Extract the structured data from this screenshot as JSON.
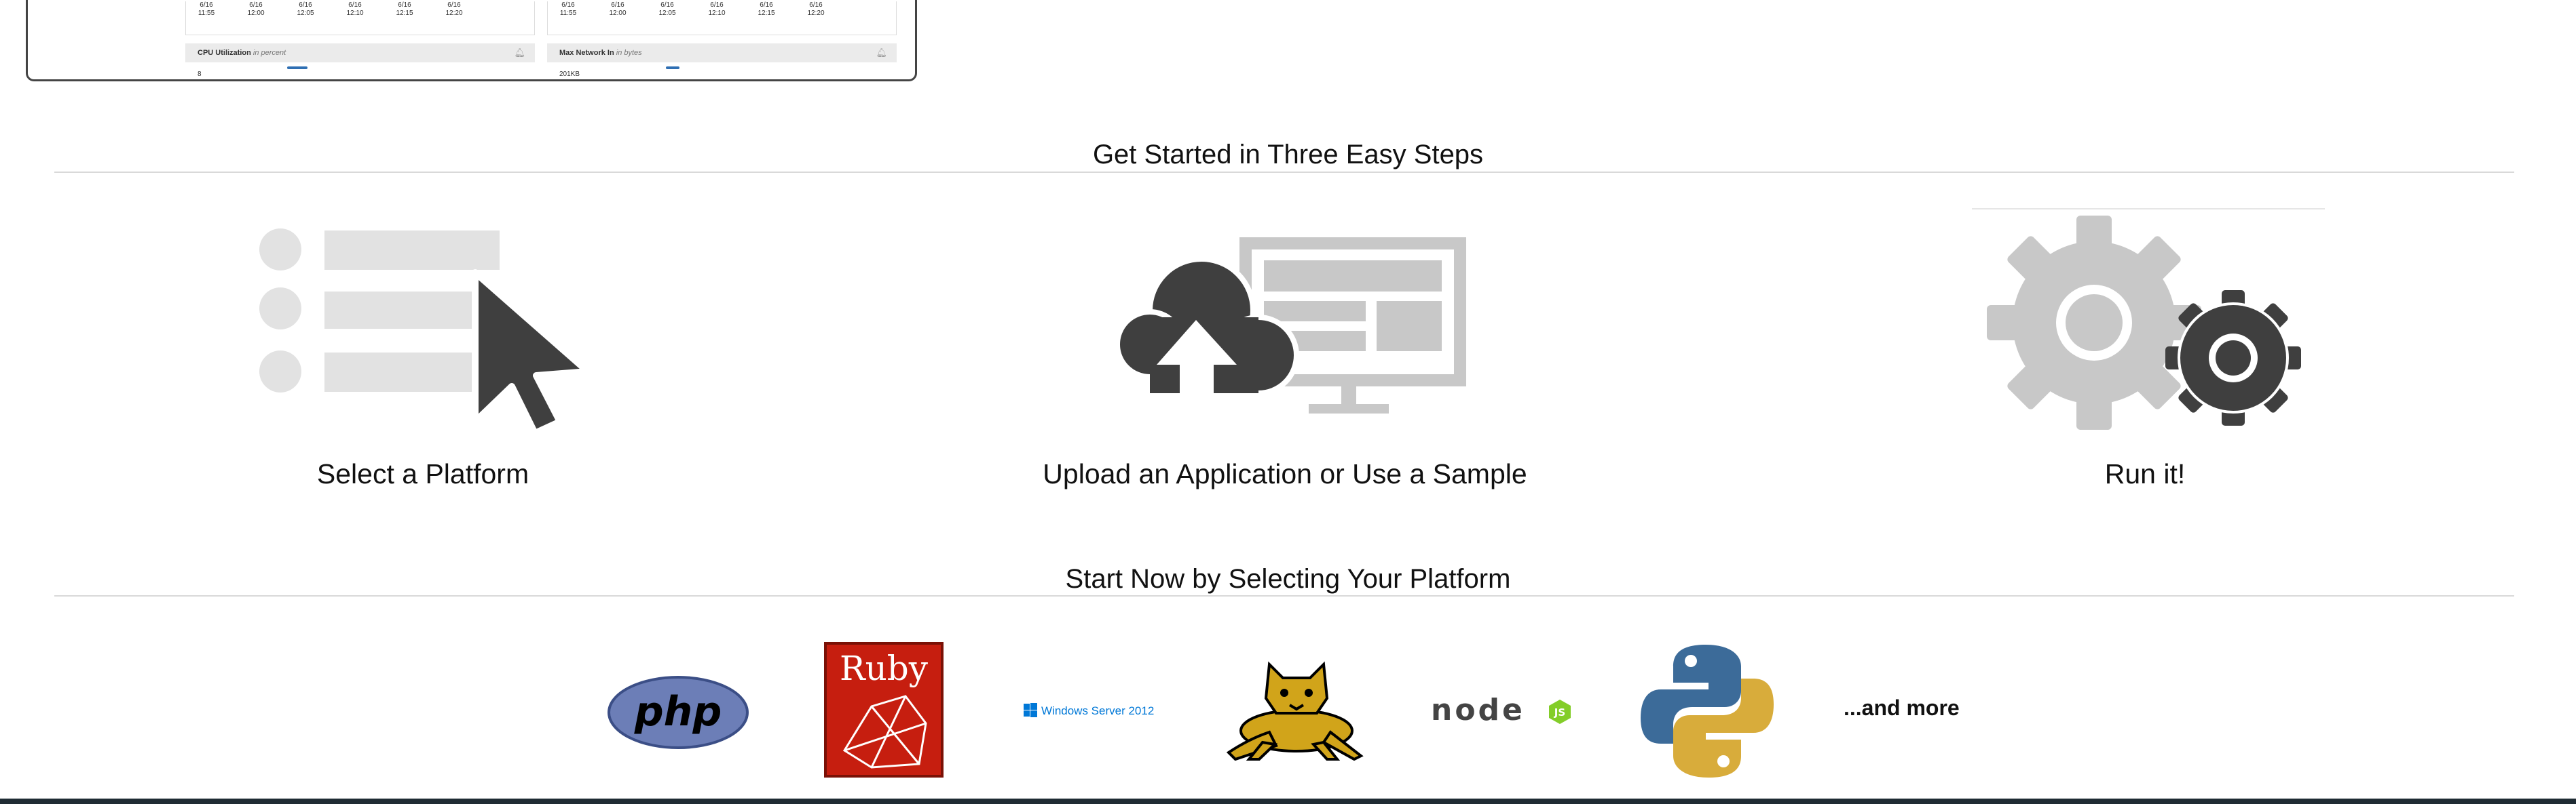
{
  "preview": {
    "left_panel": {
      "ticks": [
        {
          "date": "6/16",
          "time": "11:55"
        },
        {
          "date": "6/16",
          "time": "12:00"
        },
        {
          "date": "6/16",
          "time": "12:05"
        },
        {
          "date": "6/16",
          "time": "12:10"
        },
        {
          "date": "6/16",
          "time": "12:15"
        },
        {
          "date": "6/16",
          "time": "12:20"
        }
      ],
      "metric_name": "CPU Utilization",
      "metric_unit": "in percent",
      "axis_value": "8"
    },
    "right_panel": {
      "ticks": [
        {
          "date": "6/16",
          "time": "11:55"
        },
        {
          "date": "6/16",
          "time": "12:00"
        },
        {
          "date": "6/16",
          "time": "12:05"
        },
        {
          "date": "6/16",
          "time": "12:10"
        },
        {
          "date": "6/16",
          "time": "12:15"
        },
        {
          "date": "6/16",
          "time": "12:20"
        }
      ],
      "metric_name": "Max Network In",
      "metric_unit": "in bytes",
      "axis_value": "201KB"
    },
    "bell_icon": "bell-icon"
  },
  "steps_section": {
    "title": "Get Started in Three Easy Steps",
    "steps": [
      {
        "label": "Select a Platform",
        "icon": "select-platform-icon"
      },
      {
        "label": "Upload an Application or Use a Sample",
        "icon": "upload-cloud-icon"
      },
      {
        "label": "Run it!",
        "icon": "gears-icon"
      }
    ]
  },
  "platform_section": {
    "title": "Start Now by Selecting Your Platform",
    "platforms": [
      {
        "name": "PHP",
        "logo_text": "php",
        "color": "#6c7eb7"
      },
      {
        "name": "Ruby",
        "logo_text": "Ruby",
        "color": "#c61e0f"
      },
      {
        "name": "Windows Server 2012",
        "logo_text": "Windows Server 2012",
        "color": "#0078d7"
      },
      {
        "name": "Tomcat",
        "icon": "tomcat-logo",
        "color": "#d1a41a"
      },
      {
        "name": "Node.js",
        "logo_text": "node",
        "color": "#83cd29"
      },
      {
        "name": "Python",
        "icon": "python-logo",
        "color": "#3c6b99"
      }
    ],
    "more_label": "...and more"
  },
  "colors": {
    "icon_dark": "#3f3f3f",
    "icon_light": "#c8c8c8",
    "icon_lighter": "#e2e2e2",
    "rule": "#d9d9d9"
  }
}
